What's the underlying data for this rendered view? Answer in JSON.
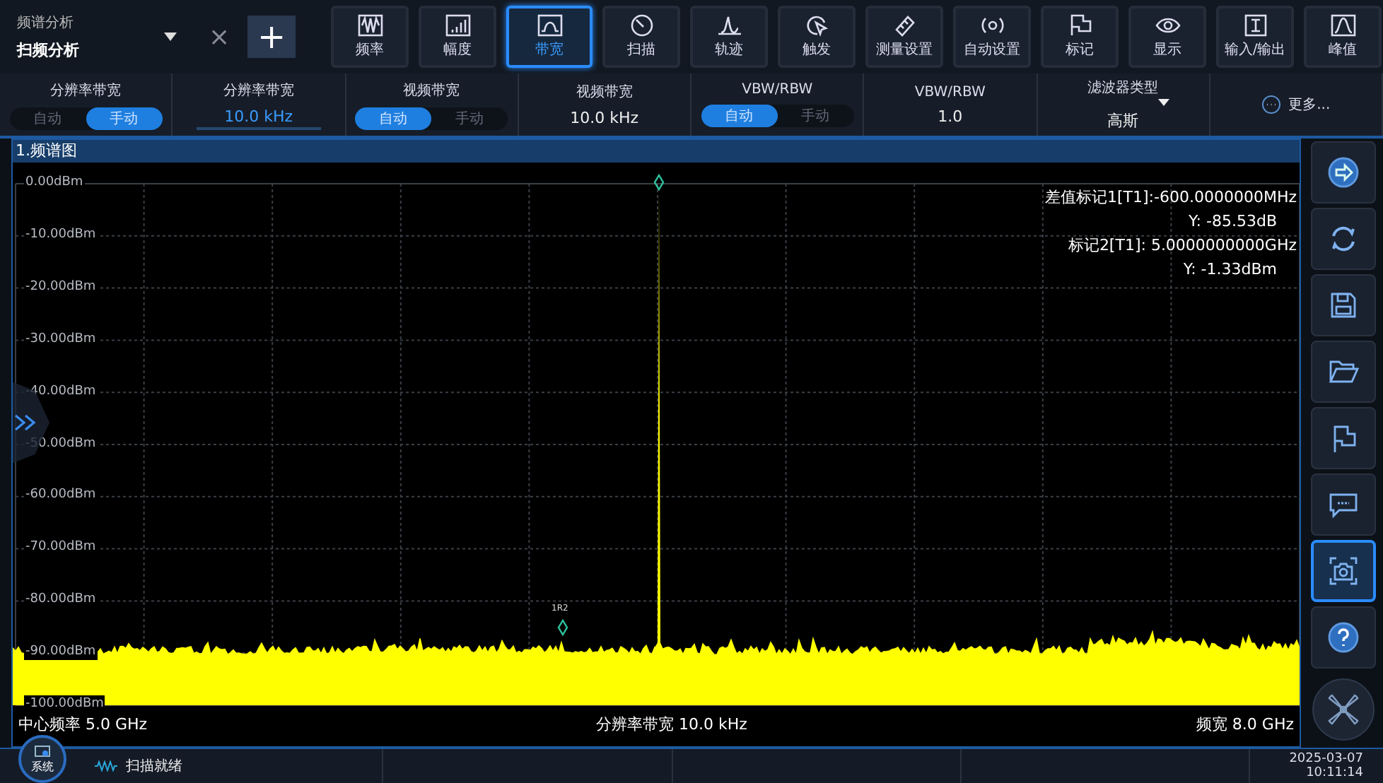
{
  "app": {
    "mode_label": "频谱分析",
    "mode": "扫频分析",
    "close": "×",
    "add": "+"
  },
  "toolbar": [
    {
      "label": "频率",
      "selected": false
    },
    {
      "label": "幅度",
      "selected": false
    },
    {
      "label": "带宽",
      "selected": true
    },
    {
      "label": "扫描",
      "selected": false
    },
    {
      "label": "轨迹",
      "selected": false
    },
    {
      "label": "触发",
      "selected": false
    },
    {
      "label": "测量设置",
      "selected": false
    },
    {
      "label": "自动设置",
      "selected": false
    },
    {
      "label": "标记",
      "selected": false
    },
    {
      "label": "显示",
      "selected": false
    },
    {
      "label": "输入/输出",
      "selected": false
    },
    {
      "label": "峰值",
      "selected": false
    }
  ],
  "params": [
    {
      "kind": "toggle",
      "label": "分辨率带宽",
      "options": [
        {
          "label": "自动",
          "selected": false
        },
        {
          "label": "手动",
          "selected": true
        }
      ]
    },
    {
      "kind": "value",
      "label": "分辨率带宽",
      "value": "10.0 kHz",
      "active": true
    },
    {
      "kind": "toggle",
      "label": "视频带宽",
      "options": [
        {
          "label": "自动",
          "selected": true
        },
        {
          "label": "手动",
          "selected": false
        }
      ]
    },
    {
      "kind": "value",
      "label": "视频带宽",
      "value": "10.0 kHz",
      "active": false
    },
    {
      "kind": "toggle",
      "label": "VBW/RBW",
      "options": [
        {
          "label": "自动",
          "selected": true
        },
        {
          "label": "手动",
          "selected": false
        }
      ]
    },
    {
      "kind": "value",
      "label": "VBW/RBW",
      "value": "1.0",
      "active": false
    },
    {
      "kind": "dropdown",
      "label": "滤波器类型",
      "value": "高斯"
    },
    {
      "kind": "more",
      "label": "更多..."
    }
  ],
  "panel": {
    "title": "1.频谱图",
    "y_labels": [
      "0.00dBm",
      "-10.00dBm",
      "-20.00dBm",
      "-30.00dBm",
      "-40.00dBm",
      "-50.00dBm",
      "-60.00dBm",
      "-70.00dBm",
      "-80.00dBm",
      "-90.00dBm",
      "-100.00dBm"
    ],
    "readouts": [
      "差值标记1[T1]:-600.0000000MHz",
      "Y: -85.53dB",
      "标记2[T1]: 5.0000000000GHz",
      "Y: -1.33dBm"
    ],
    "marker_label": "1R2",
    "footer": [
      "中心频率 5.0 GHz",
      "分辨率带宽 10.0 kHz",
      "频宽 8.0 GHz"
    ]
  },
  "side_buttons": [
    {
      "selected": false
    },
    {
      "selected": false
    },
    {
      "selected": false
    },
    {
      "selected": false
    },
    {
      "selected": false
    },
    {
      "selected": false
    },
    {
      "selected": true
    },
    {
      "selected": false
    }
  ],
  "status": {
    "system": "系统",
    "state": "扫描就绪",
    "date": "2025-03-07",
    "time": "10:11:14"
  }
}
